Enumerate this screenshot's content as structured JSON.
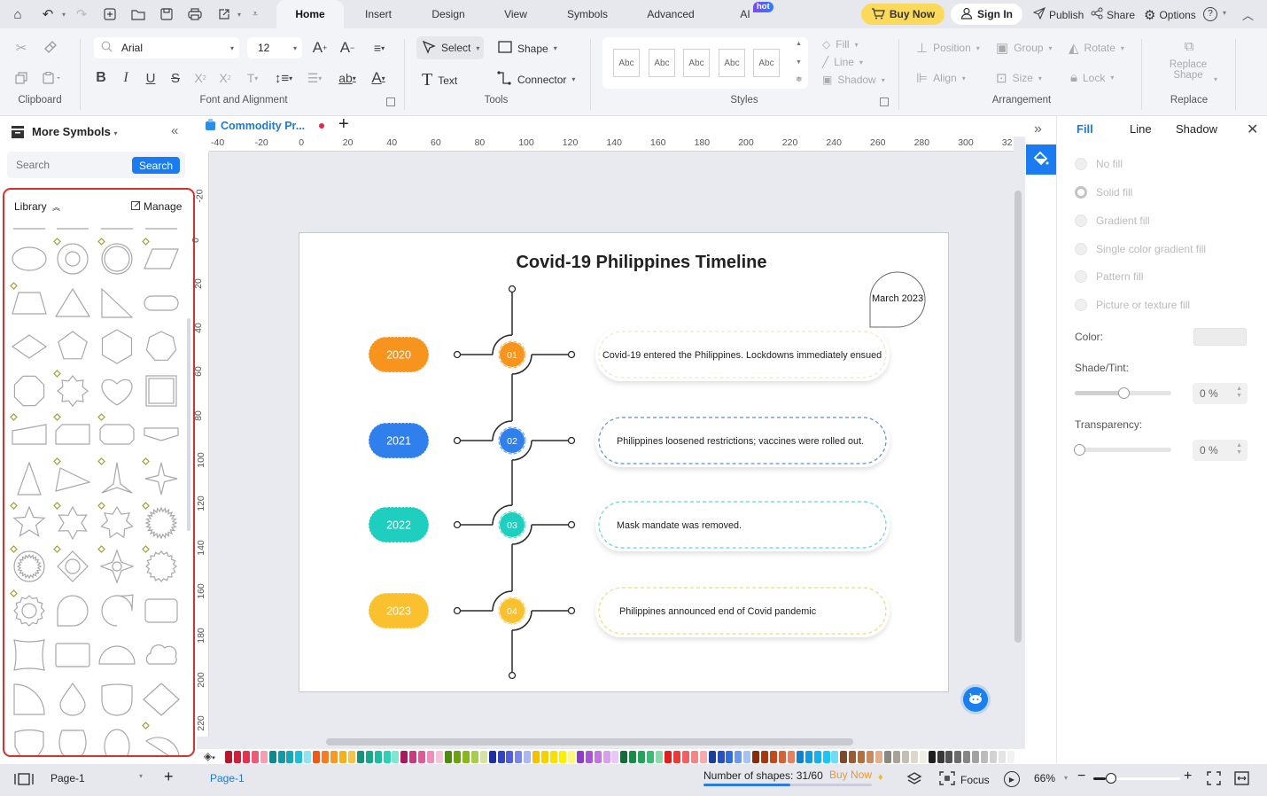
{
  "quick_access": {
    "icons": [
      "home-icon",
      "undo-icon",
      "redo-icon",
      "new-icon",
      "open-folder-icon",
      "save-icon",
      "print-icon",
      "export-icon",
      "more-icon"
    ]
  },
  "menu_tabs": [
    {
      "label": "Home",
      "active": true
    },
    {
      "label": "Insert"
    },
    {
      "label": "Design"
    },
    {
      "label": "View"
    },
    {
      "label": "Symbols"
    },
    {
      "label": "Advanced"
    },
    {
      "label": "AI",
      "badge": "hot"
    }
  ],
  "header_actions": {
    "buy_now": "Buy Now",
    "sign_in": "Sign In",
    "publish": "Publish",
    "share": "Share",
    "options": "Options"
  },
  "ribbon": {
    "clipboard": {
      "label": "Clipboard"
    },
    "font": {
      "label": "Font and Alignment",
      "font_family": "Arial",
      "font_size": "12"
    },
    "tools": {
      "label": "Tools",
      "select": "Select",
      "shape": "Shape",
      "text": "Text",
      "connector": "Connector"
    },
    "styles": {
      "label": "Styles",
      "swatches": [
        "Abc",
        "Abc",
        "Abc",
        "Abc",
        "Abc"
      ],
      "fill": "Fill",
      "line": "Line",
      "shadow": "Shadow"
    },
    "arrangement": {
      "label": "Arrangement",
      "position": "Position",
      "group": "Group",
      "rotate": "Rotate",
      "align": "Align",
      "size": "Size",
      "lock": "Lock"
    },
    "replace": {
      "label": "Replace",
      "replace_shape": "Replace Shape"
    }
  },
  "left_panel": {
    "title": "More Symbols",
    "search_placeholder": "Search",
    "search_button": "Search",
    "library_label": "Library",
    "manage_label": "Manage"
  },
  "document": {
    "tab_title": "Commodity Pr...",
    "unsaved": true
  },
  "rulers": {
    "horizontal": [
      "-40",
      "-20",
      "0",
      "20",
      "40",
      "60",
      "80",
      "100",
      "120",
      "140",
      "160",
      "180",
      "200",
      "220",
      "240",
      "260",
      "280",
      "300",
      "32"
    ],
    "vertical": [
      "-20",
      "0",
      "20",
      "40",
      "60",
      "80",
      "100",
      "120",
      "140",
      "160",
      "180",
      "200",
      "220"
    ]
  },
  "diagram": {
    "title": "Covid-19 Philippines Timeline",
    "callout": "March 2023",
    "events": [
      {
        "year": "2020",
        "step": "01",
        "text": "Covid-19 entered the Philippines. Lockdowns immediately ensued",
        "color": "#f7941d",
        "border": "#efe6c8"
      },
      {
        "year": "2021",
        "step": "02",
        "text": "Philippines loosened restrictions; vaccines were rolled out.",
        "color": "#2f80ed",
        "border": "#5b8ed6"
      },
      {
        "year": "2022",
        "step": "03",
        "text": "Mask mandate was removed.",
        "color": "#1ecfbf",
        "border": "#5fd3e0"
      },
      {
        "year": "2023",
        "step": "04",
        "text": "Philippines announced end of Covid pandemic",
        "color": "#fbc02d",
        "border": "#f2d77a"
      }
    ]
  },
  "right_panel": {
    "tabs": [
      {
        "label": "Fill",
        "active": true
      },
      {
        "label": "Line"
      },
      {
        "label": "Shadow"
      }
    ],
    "fill_options": [
      "No fill",
      "Solid fill",
      "Gradient fill",
      "Single color gradient fill",
      "Pattern fill",
      "Picture or texture fill"
    ],
    "selected_fill": "Solid fill",
    "color_label": "Color:",
    "shade_label": "Shade/Tint:",
    "shade_value": "0 %",
    "shade_slider": 0.5,
    "transparency_label": "Transparency:",
    "transparency_value": "0 %",
    "transparency_slider": 0
  },
  "palette": [
    "#b5182b",
    "#d01f3c",
    "#e2334f",
    "#ee5a78",
    "#f59fb4",
    "#0e8a8c",
    "#1597a5",
    "#17a8b8",
    "#1cbfd6",
    "#8fe3f0",
    "#f0581a",
    "#f57c1f",
    "#f79a25",
    "#f6b01b",
    "#f5c24a",
    "#17917a",
    "#19a68a",
    "#1cbc9c",
    "#2dd1b3",
    "#7fe6d1",
    "#a61b5e",
    "#c63b7f",
    "#dd5c98",
    "#ee8ebb",
    "#f6c3dc",
    "#4f8a10",
    "#6aa212",
    "#86b81e",
    "#a8cd4a",
    "#d4e4a0",
    "#1d2fa0",
    "#3045c4",
    "#4f5fe0",
    "#7a86ee",
    "#aeb5f5",
    "#f5c000",
    "#f7d000",
    "#f9e000",
    "#fbf000",
    "#fdf77a",
    "#8e3cc8",
    "#a855d8",
    "#c077e4",
    "#d6a0ee",
    "#e8c8f6",
    "#146c3a",
    "#1a8a47",
    "#22a55a",
    "#3dbb74",
    "#8ad9a8",
    "#e01e1e",
    "#ea3a3a",
    "#f06060",
    "#f48585",
    "#f8aaaa",
    "#1c3d9c",
    "#2450c0",
    "#2e6ce0",
    "#6e98ec",
    "#a8c2f4",
    "#8a2a0a",
    "#a53a12",
    "#c04a1c",
    "#d66038",
    "#e88060",
    "#1180d0",
    "#139ae0",
    "#16b0ee",
    "#1cc6f4",
    "#70dcf8",
    "#7a4a2a",
    "#985c34",
    "#b07040",
    "#c88a5e",
    "#e4ae8a",
    "#8a8680",
    "#a8a298",
    "#c4beb2",
    "#ded8cc",
    "#f2ede2",
    "#1e1e1e",
    "#383838",
    "#525252",
    "#6c6c6c",
    "#868686",
    "#a2a2a2",
    "#bcbcbc",
    "#d2d2d2",
    "#e4e4e4",
    "#f2f2f2"
  ],
  "statusbar": {
    "page_selector": "Page-1",
    "page_tab": "Page-1",
    "shape_count_label": "Number of shapes: 31/60",
    "shape_usage": 0.517,
    "buy_now": "Buy Now",
    "focus": "Focus",
    "zoom": "66%",
    "zoom_slider": 0.12
  }
}
